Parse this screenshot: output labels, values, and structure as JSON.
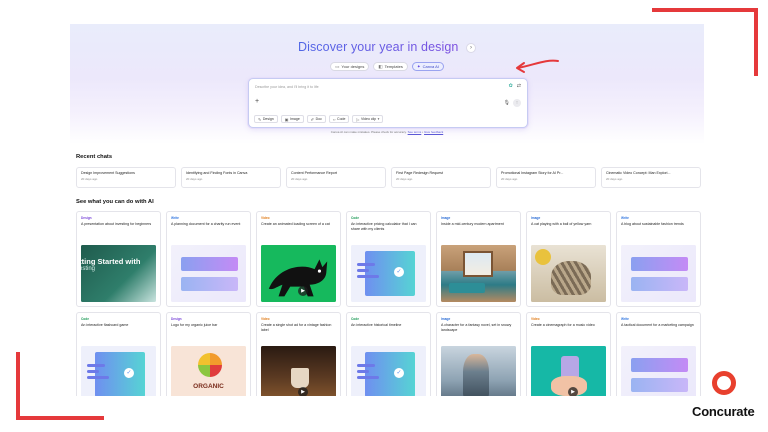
{
  "hero": {
    "title": "Discover your year in design",
    "title_chevron": "›",
    "tabs": [
      {
        "icon": "▭",
        "label": "Your designs"
      },
      {
        "icon": "◧",
        "label": "Templates"
      },
      {
        "icon": "✦",
        "label": "Canva AI"
      }
    ]
  },
  "prompt": {
    "placeholder": "Describe your idea, and I'll bring it to life",
    "plus": "+",
    "mic": "🎙",
    "send": "↑",
    "chips": [
      {
        "icon": "✎",
        "label": "Design"
      },
      {
        "icon": "▣",
        "label": "Image"
      },
      {
        "icon": "✐",
        "label": "Doc"
      },
      {
        "icon": "‹›",
        "label": "Code"
      },
      {
        "icon": "▷",
        "label": "Video clip"
      }
    ]
  },
  "disclaimer": {
    "text": "Canva AI can make mistakes. Please check for accuracy.",
    "link1": "See terms",
    "sep": "•",
    "link2": "Give feedback"
  },
  "recent": {
    "heading": "Recent chats",
    "items": [
      {
        "title": "Design Improvement Suggestions",
        "time": "20 days ago"
      },
      {
        "title": "Identifying and Finding Fonts in Canva",
        "time": "20 days ago"
      },
      {
        "title": "Content Performance Report",
        "time": "20 days ago"
      },
      {
        "title": "First Page Redesign Request",
        "time": "20 days ago"
      },
      {
        "title": "Promotional Instagram Story for AI Pr...",
        "time": "20 days ago"
      },
      {
        "title": "Cinematic Video Concept: Man Explori...",
        "time": "20 days ago"
      }
    ]
  },
  "ai": {
    "heading": "See what you can do with AI",
    "cards": [
      {
        "type": "Design",
        "cls": "t-design",
        "desc": "A presentation about investing for beginners",
        "thumb": "pres",
        "thumb_text": "etting Started with",
        "thumb_text2": "esting"
      },
      {
        "type": "Write",
        "cls": "t-write",
        "desc": "A planning document for a charity run event",
        "thumb": "grad"
      },
      {
        "type": "Video",
        "cls": "t-video",
        "desc": "Create an animated loading screen of a cat",
        "thumb": "cat",
        "play": "▶"
      },
      {
        "type": "Code",
        "cls": "t-code",
        "desc": "An interactive pricing calculator that I can share with my clients",
        "thumb": "code"
      },
      {
        "type": "Image",
        "cls": "t-image",
        "desc": "Inside a mid-century modern apartment",
        "thumb": "room"
      },
      {
        "type": "Image",
        "cls": "t-image",
        "desc": "A cat playing with a ball of yellow yarn",
        "thumb": "yarncat"
      },
      {
        "type": "Write",
        "cls": "t-write",
        "desc": "A blog about sustainable fashion trends",
        "thumb": "grad"
      },
      {
        "type": "Code",
        "cls": "t-code",
        "desc": "An interactive flashcard game",
        "thumb": "code"
      },
      {
        "type": "Design",
        "cls": "t-design",
        "desc": "Logo for my organic juice bar",
        "thumb": "organic",
        "thumb_text": "ORGANIC"
      },
      {
        "type": "Video",
        "cls": "t-video",
        "desc": "Create a single shot ad for a vintage fashion label",
        "thumb": "cafe",
        "play": "▶"
      },
      {
        "type": "Code",
        "cls": "t-code",
        "desc": "An interactive historical timeline",
        "thumb": "code"
      },
      {
        "type": "Image",
        "cls": "t-image",
        "desc": "A character for a fantasy novel, set in snowy landscape",
        "thumb": "warrior"
      },
      {
        "type": "Video",
        "cls": "t-video",
        "desc": "Create a cinemagraph for a music video",
        "thumb": "spray",
        "play": "▶"
      },
      {
        "type": "Write",
        "cls": "t-write",
        "desc": "A tactical document for a marketing campaign",
        "thumb": "grad"
      }
    ]
  },
  "brand": {
    "name": "Concurate",
    "accent": "#e5393b"
  }
}
